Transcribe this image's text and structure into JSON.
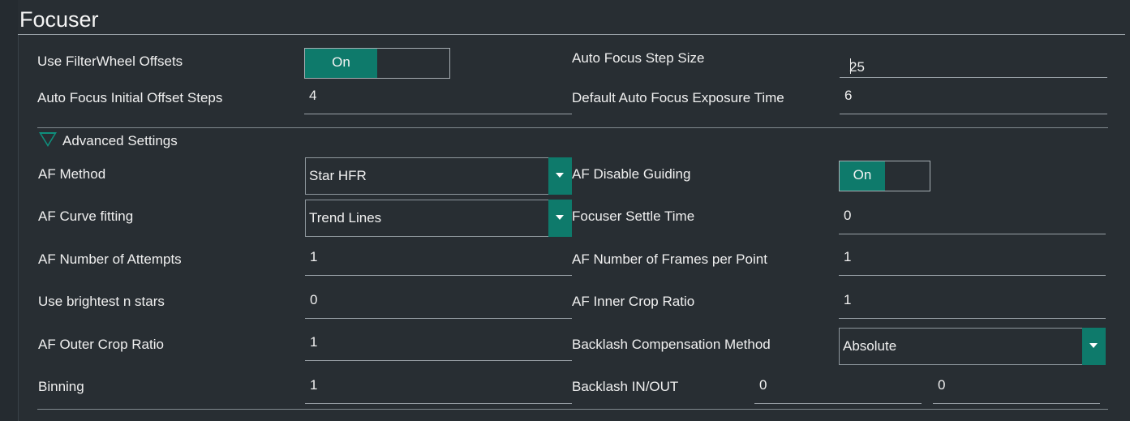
{
  "header": {
    "title": "Focuser"
  },
  "basic": {
    "use_filterwheel_offsets": {
      "label": "Use FilterWheel Offsets",
      "toggle": "On"
    },
    "af_step_size": {
      "label": "Auto Focus Step Size",
      "value": "25"
    },
    "af_initial_offset": {
      "label": "Auto Focus Initial Offset Steps",
      "value": "4"
    },
    "af_exposure_time": {
      "label": "Default Auto Focus Exposure Time",
      "value": "6"
    }
  },
  "advanced": {
    "expander_label": "Advanced Settings",
    "af_method": {
      "label": "AF Method",
      "value": "Star HFR"
    },
    "af_disable_guiding": {
      "label": "AF Disable Guiding",
      "toggle": "On"
    },
    "af_curve_fitting": {
      "label": "AF Curve fitting",
      "value": "Trend Lines"
    },
    "focuser_settle_time": {
      "label": "Focuser Settle Time",
      "value": "0"
    },
    "af_attempts": {
      "label": "AF Number of Attempts",
      "value": "1"
    },
    "af_frames_per_point": {
      "label": "AF Number of Frames per Point",
      "value": "1"
    },
    "brightest_stars": {
      "label": "Use brightest n stars",
      "value": "0"
    },
    "af_inner_crop": {
      "label": "AF Inner Crop Ratio",
      "value": "1"
    },
    "af_outer_crop": {
      "label": "AF Outer Crop Ratio",
      "value": "1"
    },
    "backlash_method": {
      "label": "Backlash Compensation Method",
      "value": "Absolute"
    },
    "binning": {
      "label": "Binning",
      "value": "1"
    },
    "backlash_in_out": {
      "label": "Backlash IN/OUT",
      "in_value": "0",
      "out_value": "0"
    }
  },
  "colors": {
    "background": "#282e33",
    "accent": "#0e7a6b",
    "text": "#f0f0f0",
    "rule": "#9aa2a8"
  },
  "icons": {
    "expander": "triangle-down-outline-icon",
    "dropdown": "chevron-down-icon"
  }
}
